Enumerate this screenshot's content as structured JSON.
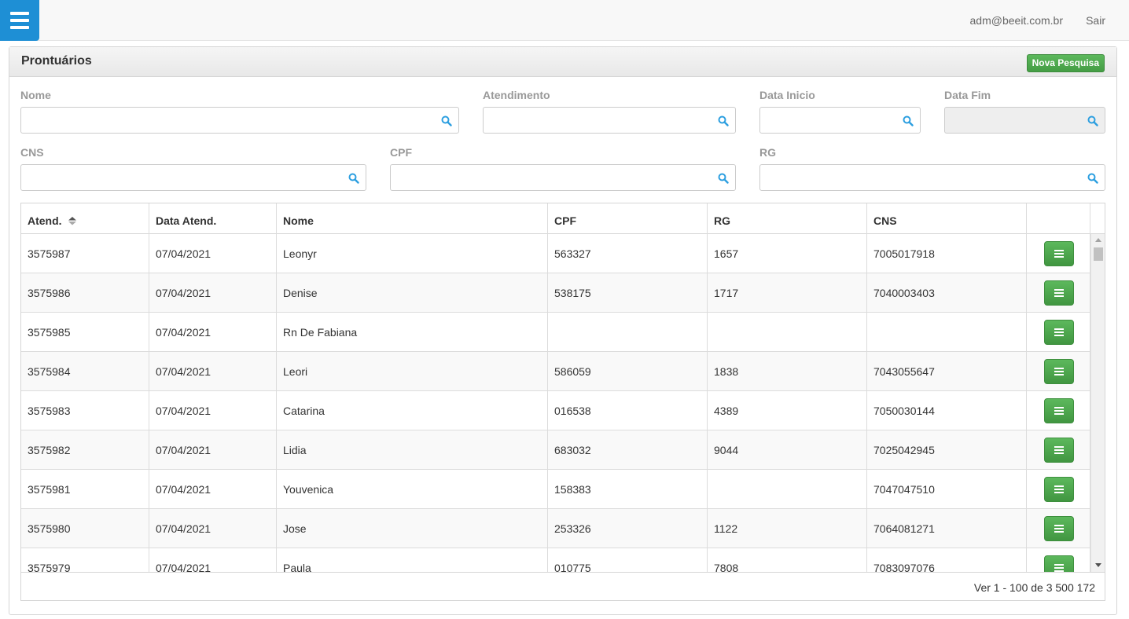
{
  "header": {
    "menu_icon": "hamburger-menu-icon",
    "user_email": "adm@beeit.com.br",
    "logout_label": "Sair"
  },
  "panel": {
    "title": "Prontuários",
    "new_search_label": "Nova Pesquisa"
  },
  "filters": {
    "nome": {
      "label": "Nome",
      "value": ""
    },
    "atendimento": {
      "label": "Atendimento",
      "value": ""
    },
    "data_inicio": {
      "label": "Data Inicio",
      "value": ""
    },
    "data_fim": {
      "label": "Data Fim",
      "value": ""
    },
    "cns": {
      "label": "CNS",
      "value": ""
    },
    "cpf": {
      "label": "CPF",
      "value": ""
    },
    "rg": {
      "label": "RG",
      "value": ""
    }
  },
  "grid": {
    "columns": [
      "Atend.",
      "Data Atend.",
      "Nome",
      "CPF",
      "RG",
      "CNS",
      ""
    ],
    "sort_column": "Atend.",
    "rows": [
      {
        "atend": "3575987",
        "data": "07/04/2021",
        "nome": "Leonyr",
        "cpf": "563327",
        "rg": "1657",
        "cns": "7005017918"
      },
      {
        "atend": "3575986",
        "data": "07/04/2021",
        "nome": "Denise",
        "cpf": "538175",
        "rg": "1717",
        "cns": "7040003403"
      },
      {
        "atend": "3575985",
        "data": "07/04/2021",
        "nome": "Rn De Fabiana",
        "cpf": "",
        "rg": "",
        "cns": ""
      },
      {
        "atend": "3575984",
        "data": "07/04/2021",
        "nome": "Leori",
        "cpf": "586059",
        "rg": "1838",
        "cns": "7043055647"
      },
      {
        "atend": "3575983",
        "data": "07/04/2021",
        "nome": "Catarina",
        "cpf": "016538",
        "rg": "4389",
        "cns": "7050030144"
      },
      {
        "atend": "3575982",
        "data": "07/04/2021",
        "nome": "Lidia",
        "cpf": "683032",
        "rg": "9044",
        "cns": "7025042945"
      },
      {
        "atend": "3575981",
        "data": "07/04/2021",
        "nome": "Youvenica",
        "cpf": "158383",
        "rg": "",
        "cns": "7047047510"
      },
      {
        "atend": "3575980",
        "data": "07/04/2021",
        "nome": "Jose",
        "cpf": "253326",
        "rg": "1122",
        "cns": "7064081271"
      },
      {
        "atend": "3575979",
        "data": "07/04/2021",
        "nome": "Paula",
        "cpf": "010775",
        "rg": "7808",
        "cns": "7083097076"
      }
    ],
    "row_action_icon": "list-icon",
    "pager_text": "Ver 1 - 100 de 3 500 172"
  }
}
